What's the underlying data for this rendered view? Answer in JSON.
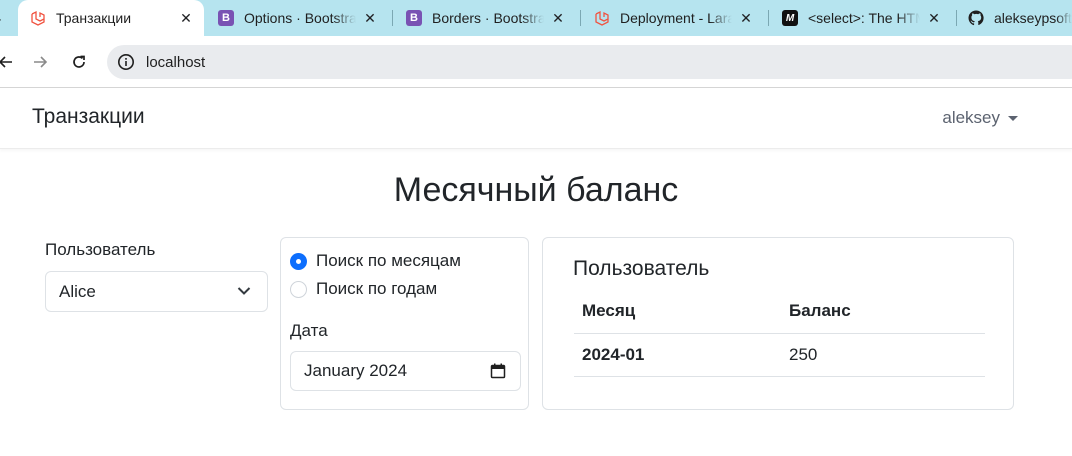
{
  "browser": {
    "tabs": [
      {
        "title": "Транзакции",
        "icon": "laravel-icon",
        "active": true
      },
      {
        "title": "Options · Bootstrap",
        "icon": "bootstrap-icon"
      },
      {
        "title": "Borders · Bootstrap",
        "icon": "bootstrap-icon"
      },
      {
        "title": "Deployment - Laravel",
        "icon": "laravel-icon"
      },
      {
        "title": "<select>: The HTML",
        "icon": "mdn-icon"
      },
      {
        "title": "alekseypsoft",
        "icon": "github-icon"
      }
    ],
    "address": "localhost"
  },
  "navbar": {
    "brand": "Транзакции",
    "user": "aleksey"
  },
  "main": {
    "heading": "Месячный баланс",
    "user_label": "Пользователь",
    "user_selected": "Alice",
    "radios": [
      {
        "label": "Поиск по месяцам",
        "checked": true
      },
      {
        "label": "Поиск по годам",
        "checked": false
      }
    ],
    "date_label": "Дата",
    "date_value": "January 2024",
    "result": {
      "title": "Пользователь",
      "columns": [
        "Месяц",
        "Баланс"
      ],
      "rows": [
        {
          "month": "2024-01",
          "balance": "250"
        }
      ]
    }
  },
  "colors": {
    "tabbar": "#b6e4ef",
    "accent": "#0d6efd",
    "border": "#dee2e6"
  }
}
